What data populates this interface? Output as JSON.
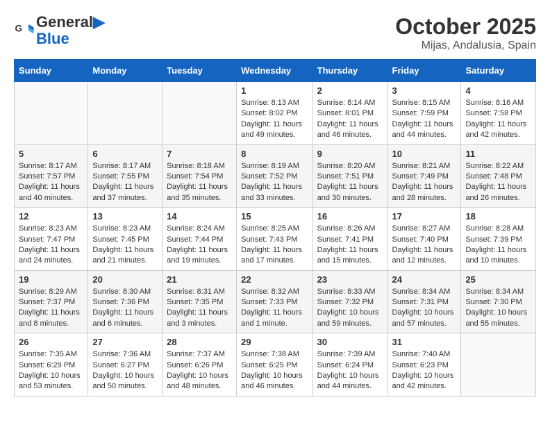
{
  "header": {
    "logo_line1": "General",
    "logo_line2": "Blue",
    "month": "October 2025",
    "location": "Mijas, Andalusia, Spain"
  },
  "days_of_week": [
    "Sunday",
    "Monday",
    "Tuesday",
    "Wednesday",
    "Thursday",
    "Friday",
    "Saturday"
  ],
  "weeks": [
    [
      {
        "day": "",
        "info": ""
      },
      {
        "day": "",
        "info": ""
      },
      {
        "day": "",
        "info": ""
      },
      {
        "day": "1",
        "info": "Sunrise: 8:13 AM\nSunset: 8:02 PM\nDaylight: 11 hours and 49 minutes."
      },
      {
        "day": "2",
        "info": "Sunrise: 8:14 AM\nSunset: 8:01 PM\nDaylight: 11 hours and 46 minutes."
      },
      {
        "day": "3",
        "info": "Sunrise: 8:15 AM\nSunset: 7:59 PM\nDaylight: 11 hours and 44 minutes."
      },
      {
        "day": "4",
        "info": "Sunrise: 8:16 AM\nSunset: 7:58 PM\nDaylight: 11 hours and 42 minutes."
      }
    ],
    [
      {
        "day": "5",
        "info": "Sunrise: 8:17 AM\nSunset: 7:57 PM\nDaylight: 11 hours and 40 minutes."
      },
      {
        "day": "6",
        "info": "Sunrise: 8:17 AM\nSunset: 7:55 PM\nDaylight: 11 hours and 37 minutes."
      },
      {
        "day": "7",
        "info": "Sunrise: 8:18 AM\nSunset: 7:54 PM\nDaylight: 11 hours and 35 minutes."
      },
      {
        "day": "8",
        "info": "Sunrise: 8:19 AM\nSunset: 7:52 PM\nDaylight: 11 hours and 33 minutes."
      },
      {
        "day": "9",
        "info": "Sunrise: 8:20 AM\nSunset: 7:51 PM\nDaylight: 11 hours and 30 minutes."
      },
      {
        "day": "10",
        "info": "Sunrise: 8:21 AM\nSunset: 7:49 PM\nDaylight: 11 hours and 28 minutes."
      },
      {
        "day": "11",
        "info": "Sunrise: 8:22 AM\nSunset: 7:48 PM\nDaylight: 11 hours and 26 minutes."
      }
    ],
    [
      {
        "day": "12",
        "info": "Sunrise: 8:23 AM\nSunset: 7:47 PM\nDaylight: 11 hours and 24 minutes."
      },
      {
        "day": "13",
        "info": "Sunrise: 8:23 AM\nSunset: 7:45 PM\nDaylight: 11 hours and 21 minutes."
      },
      {
        "day": "14",
        "info": "Sunrise: 8:24 AM\nSunset: 7:44 PM\nDaylight: 11 hours and 19 minutes."
      },
      {
        "day": "15",
        "info": "Sunrise: 8:25 AM\nSunset: 7:43 PM\nDaylight: 11 hours and 17 minutes."
      },
      {
        "day": "16",
        "info": "Sunrise: 8:26 AM\nSunset: 7:41 PM\nDaylight: 11 hours and 15 minutes."
      },
      {
        "day": "17",
        "info": "Sunrise: 8:27 AM\nSunset: 7:40 PM\nDaylight: 11 hours and 12 minutes."
      },
      {
        "day": "18",
        "info": "Sunrise: 8:28 AM\nSunset: 7:39 PM\nDaylight: 11 hours and 10 minutes."
      }
    ],
    [
      {
        "day": "19",
        "info": "Sunrise: 8:29 AM\nSunset: 7:37 PM\nDaylight: 11 hours and 8 minutes."
      },
      {
        "day": "20",
        "info": "Sunrise: 8:30 AM\nSunset: 7:36 PM\nDaylight: 11 hours and 6 minutes."
      },
      {
        "day": "21",
        "info": "Sunrise: 8:31 AM\nSunset: 7:35 PM\nDaylight: 11 hours and 3 minutes."
      },
      {
        "day": "22",
        "info": "Sunrise: 8:32 AM\nSunset: 7:33 PM\nDaylight: 11 hours and 1 minute."
      },
      {
        "day": "23",
        "info": "Sunrise: 8:33 AM\nSunset: 7:32 PM\nDaylight: 10 hours and 59 minutes."
      },
      {
        "day": "24",
        "info": "Sunrise: 8:34 AM\nSunset: 7:31 PM\nDaylight: 10 hours and 57 minutes."
      },
      {
        "day": "25",
        "info": "Sunrise: 8:34 AM\nSunset: 7:30 PM\nDaylight: 10 hours and 55 minutes."
      }
    ],
    [
      {
        "day": "26",
        "info": "Sunrise: 7:35 AM\nSunset: 6:29 PM\nDaylight: 10 hours and 53 minutes."
      },
      {
        "day": "27",
        "info": "Sunrise: 7:36 AM\nSunset: 6:27 PM\nDaylight: 10 hours and 50 minutes."
      },
      {
        "day": "28",
        "info": "Sunrise: 7:37 AM\nSunset: 6:26 PM\nDaylight: 10 hours and 48 minutes."
      },
      {
        "day": "29",
        "info": "Sunrise: 7:38 AM\nSunset: 6:25 PM\nDaylight: 10 hours and 46 minutes."
      },
      {
        "day": "30",
        "info": "Sunrise: 7:39 AM\nSunset: 6:24 PM\nDaylight: 10 hours and 44 minutes."
      },
      {
        "day": "31",
        "info": "Sunrise: 7:40 AM\nSunset: 6:23 PM\nDaylight: 10 hours and 42 minutes."
      },
      {
        "day": "",
        "info": ""
      }
    ]
  ]
}
